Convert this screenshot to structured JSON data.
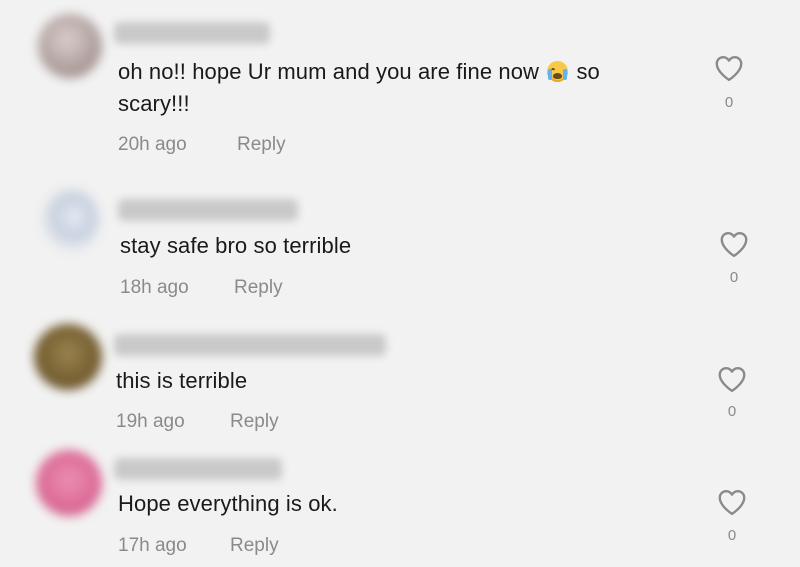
{
  "comments": [
    {
      "text_before": "oh no!! hope Ur mum and you are fine now",
      "text_after": " so",
      "text_line2": "scary!!!",
      "emoji": "loudly-crying-face-emoji",
      "time": "20h ago",
      "reply_label": "Reply",
      "likes": "0",
      "avatar_color": "#b8a9a6"
    },
    {
      "text": "stay safe bro so terrible",
      "time": "18h ago",
      "reply_label": "Reply",
      "likes": "0",
      "avatar_color": "#c7d0df"
    },
    {
      "text": "this is terrible",
      "time": "19h ago",
      "reply_label": "Reply",
      "likes": "0",
      "avatar_color": "#7a6334"
    },
    {
      "text": "Hope everything is ok.",
      "time": "17h ago",
      "reply_label": "Reply",
      "likes": "0",
      "avatar_color": "#de6f9a"
    }
  ],
  "icons": {
    "like": "heart-outline-icon"
  },
  "colors": {
    "background": "#f2f2f2",
    "text": "#1a1a1a",
    "muted": "#8a8a8a"
  }
}
